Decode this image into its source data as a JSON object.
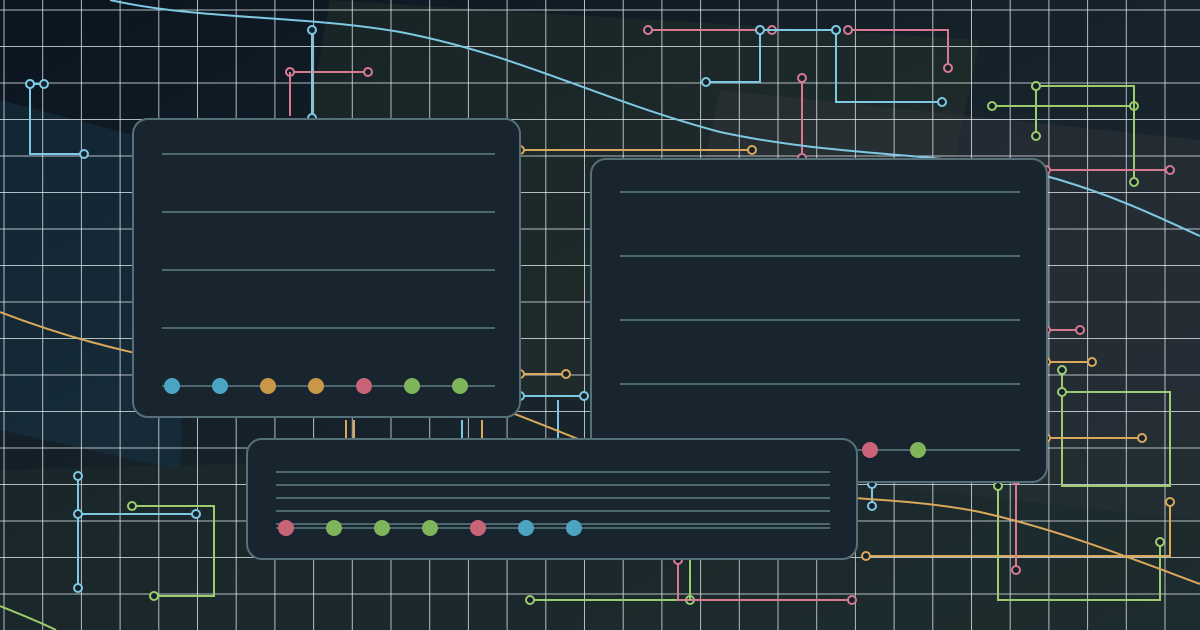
{
  "palette": {
    "background": "#0f1a22",
    "grid": "#e8eef2",
    "panel_fill": "#18242e",
    "panel_border": "#56707a",
    "panel_rule": "#5e7e84",
    "blue": "#7ec8e3",
    "pink": "#d77a8f",
    "gold": "#d9a85a",
    "green": "#9ccc6e",
    "dot_blue": "#4ba4c2",
    "dot_gold": "#c99747",
    "dot_pink": "#c96478",
    "dot_green": "#7fb45a"
  },
  "panels": [
    {
      "name": "card-top-left",
      "rules": 4,
      "dots": [
        "dot_blue",
        "dot_blue",
        "dot_gold",
        "dot_gold",
        "dot_pink",
        "dot_green",
        "dot_green"
      ]
    },
    {
      "name": "card-right",
      "rules": 4,
      "dots": [
        "dot_pink",
        "dot_green"
      ]
    },
    {
      "name": "card-bottom",
      "rules": 5,
      "dots": [
        "dot_pink",
        "dot_green",
        "dot_green",
        "dot_green",
        "dot_pink",
        "dot_blue",
        "dot_blue"
      ]
    }
  ]
}
